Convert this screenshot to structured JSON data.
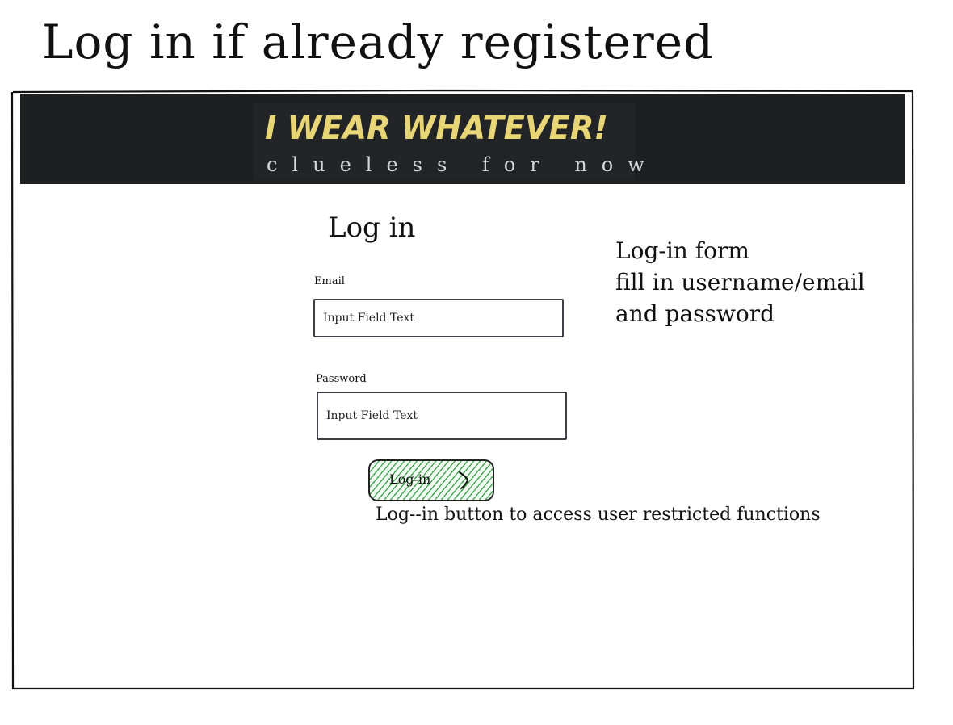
{
  "page": {
    "heading": "Log in if already registered"
  },
  "header": {
    "logo_title": "I WEAR WHATEVER!",
    "logo_subtitle": "clueless for now",
    "background_color": "#1e1f20",
    "logo_title_color": "#e8d575"
  },
  "form": {
    "heading": "Log in",
    "email": {
      "label": "Email",
      "placeholder": "Input Field Text"
    },
    "password": {
      "label": "Password",
      "placeholder": "Input Field Text"
    },
    "submit": {
      "label": "Log-in",
      "icon": "chevron-right-icon",
      "hatch_color": "#3ca04a"
    }
  },
  "annotations": {
    "form_note": [
      "Log-in form",
      "fill in username/email",
      "and password"
    ],
    "button_note": "Log--in button to access user restricted functions"
  }
}
